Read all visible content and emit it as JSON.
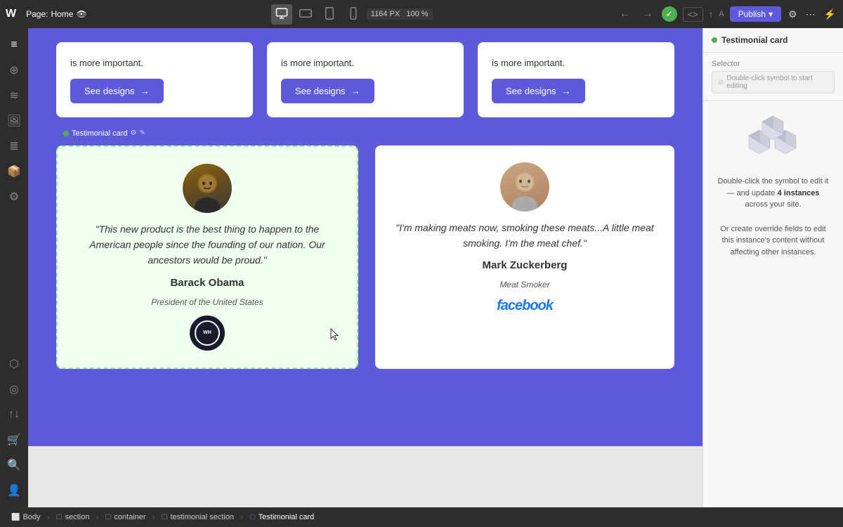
{
  "toolbar": {
    "logo": "W",
    "page_label": "Page:",
    "page_name": "Home",
    "zoom": "1164 PX",
    "zoom_percent": "100 %",
    "publish_label": "Publish",
    "device_desktop": "desktop",
    "device_tablet_h": "tablet-h",
    "device_tablet_v": "tablet-v",
    "device_mobile": "mobile"
  },
  "right_panel": {
    "title": "Testimonial card",
    "selector_label": "Selector",
    "selector_placeholder": "Double-click symbol to start editing",
    "illustration_text_1": "Double-click the symbol to edit it — and update",
    "illustration_bold": "4 instances",
    "illustration_text_2": "across your site.",
    "illustration_text_3": "Or create override fields to edit this instance's content without affecting other instances."
  },
  "top_cards": [
    {
      "text": "is more important.",
      "button_label": "See designs",
      "button_arrow": "→"
    },
    {
      "text": "is more important.",
      "button_label": "See designs",
      "button_arrow": "→"
    },
    {
      "text": "is more important.",
      "button_label": "See designs",
      "button_arrow": "→"
    }
  ],
  "testimonials": [
    {
      "id": "obama",
      "selected": true,
      "quote": "\"This new product is the best thing to happen to the American people since the founding of our nation. Our ancestors would be proud.\"",
      "name": "Barack Obama",
      "title": "President of the United States",
      "logo_type": "whitehouse"
    },
    {
      "id": "zuckerberg",
      "selected": false,
      "quote": "\"I'm making meats now, smoking these meats...A little meat smoking. I'm the meat chef.\"",
      "name": "Mark Zuckerberg",
      "title": "Meat Smoker",
      "logo_type": "facebook",
      "logo_text": "facebook"
    }
  ],
  "breadcrumb": {
    "items": [
      {
        "icon": "body",
        "label": "Body",
        "type": "body"
      },
      {
        "icon": "section",
        "label": "section",
        "type": "section"
      },
      {
        "icon": "container",
        "label": "container",
        "type": "container"
      },
      {
        "icon": "section",
        "label": "testimonial section",
        "type": "section"
      },
      {
        "icon": "symbol",
        "label": "Testimonial card",
        "type": "symbol",
        "active": true
      }
    ]
  },
  "sidebar_icons": [
    "≡",
    "⊕",
    "≋",
    "🖼",
    "≣",
    "📦",
    "⚙",
    "✦",
    "⬡",
    "☁",
    "↩",
    "↑↓",
    "⊙",
    "◎"
  ]
}
